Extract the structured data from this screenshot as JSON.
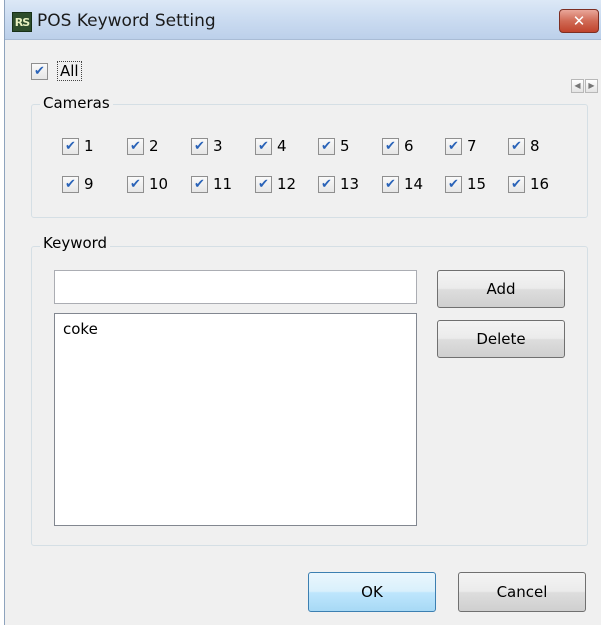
{
  "window": {
    "title": "POS Keyword Setting",
    "app_icon_text": "RS",
    "close_glyph": "✕"
  },
  "all_checkbox": {
    "label": "All",
    "checked": true
  },
  "scroll": {
    "left_glyph": "◀",
    "right_glyph": "▶"
  },
  "cameras": {
    "label": "Cameras",
    "items": [
      {
        "label": "1",
        "checked": true
      },
      {
        "label": "2",
        "checked": true
      },
      {
        "label": "3",
        "checked": true
      },
      {
        "label": "4",
        "checked": true
      },
      {
        "label": "5",
        "checked": true
      },
      {
        "label": "6",
        "checked": true
      },
      {
        "label": "7",
        "checked": true
      },
      {
        "label": "8",
        "checked": true
      },
      {
        "label": "9",
        "checked": true
      },
      {
        "label": "10",
        "checked": true
      },
      {
        "label": "11",
        "checked": true
      },
      {
        "label": "12",
        "checked": true
      },
      {
        "label": "13",
        "checked": true
      },
      {
        "label": "14",
        "checked": true
      },
      {
        "label": "15",
        "checked": true
      },
      {
        "label": "16",
        "checked": true
      }
    ]
  },
  "keyword": {
    "label": "Keyword",
    "input_value": "",
    "list": [
      "coke"
    ],
    "add_label": "Add",
    "delete_label": "Delete"
  },
  "footer": {
    "ok_label": "OK",
    "cancel_label": "Cancel"
  },
  "check_glyph": "✔",
  "icons": {
    "app": "rs-app-icon",
    "close": "close-icon",
    "scroll_left": "arrow-left-icon",
    "scroll_right": "arrow-right-icon"
  },
  "colors": {
    "title_bar": "#c9daf0",
    "close_button": "#c0432c",
    "check_mark": "#2a63b8",
    "ok_button": "#bee6fd",
    "dialog_bg": "#f0f0f0"
  }
}
